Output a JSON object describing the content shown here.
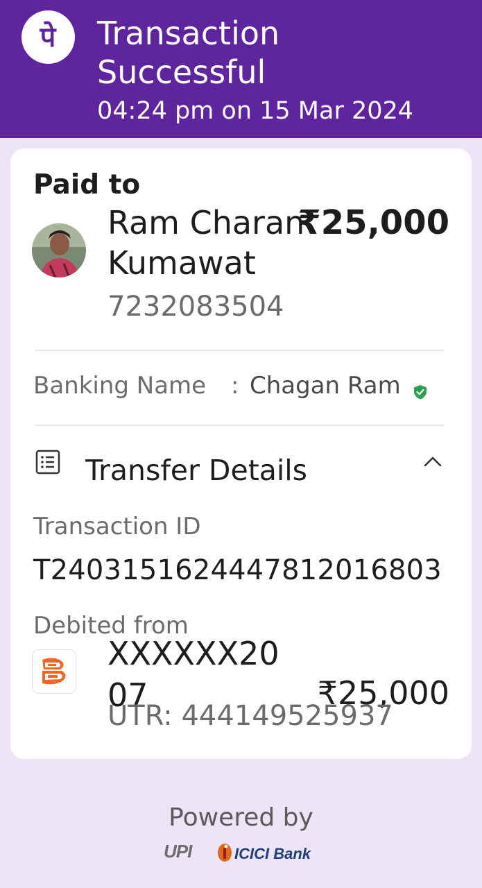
{
  "header": {
    "title": "Transaction Successful",
    "time": "04:24 pm on 15 Mar 2024",
    "logo_glyph": "पे"
  },
  "paid_to": {
    "label": "Paid to",
    "name": "Ram Charan Kumawat",
    "amount": "₹25,000",
    "phone": "7232083504"
  },
  "banking": {
    "label": "Banking Name",
    "separator": ":",
    "value": "Chagan Ram"
  },
  "transfer": {
    "title": "Transfer Details",
    "txn_label": "Transaction ID",
    "txn_id": "T2403151624447812016803",
    "debited_label": "Debited from",
    "account": "XXXXXX2007",
    "amount": "₹25,000",
    "utr": "UTR: 444149525937"
  },
  "footer": {
    "powered_by": "Powered by",
    "upi": "UPI",
    "bank": "ICICI Bank"
  },
  "colors": {
    "brand": "#5f259f",
    "page_bg": "#ede5f7",
    "verified": "#2e9e4f"
  },
  "icons": {
    "list": "list-icon",
    "chevron": "chevron-up-icon",
    "verified": "verified-shield-icon"
  }
}
